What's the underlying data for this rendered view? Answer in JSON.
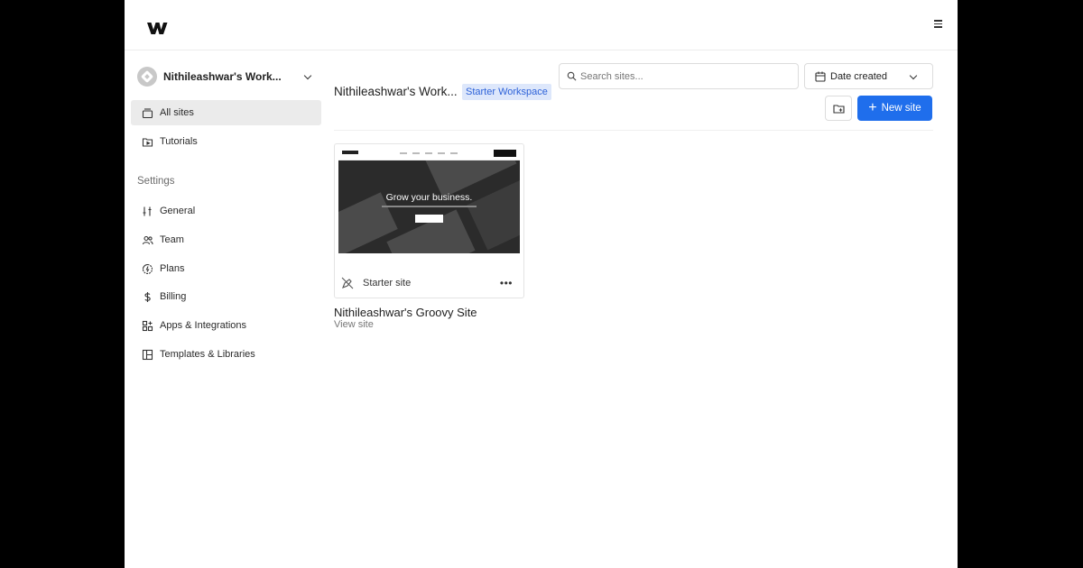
{
  "header": {
    "logo_icon": "webflow-logo-icon",
    "menu_icon": "hamburger-icon"
  },
  "sidebar": {
    "workspace_name": "Nithileashwar's Work...",
    "items": [
      {
        "label": "All sites",
        "icon": "sites-icon",
        "active": true
      },
      {
        "label": "Tutorials",
        "icon": "tutorial-icon",
        "active": false
      }
    ],
    "settings_label": "Settings",
    "settings_items": [
      {
        "label": "General",
        "icon": "sliders-icon"
      },
      {
        "label": "Team",
        "icon": "team-icon"
      },
      {
        "label": "Plans",
        "icon": "plans-icon"
      },
      {
        "label": "Billing",
        "icon": "dollar-icon"
      },
      {
        "label": "Apps & Integrations",
        "icon": "apps-icon"
      },
      {
        "label": "Templates & Libraries",
        "icon": "templates-icon"
      }
    ]
  },
  "main": {
    "workspace_title": "Nithileashwar's Work...",
    "plan_badge": "Starter Workspace",
    "search": {
      "placeholder": "Search sites..."
    },
    "sort": {
      "label": "Date created"
    },
    "new_site_label": "New site",
    "accent_color": "#1f6eec",
    "sites": [
      {
        "name": "Nithileashwar's Groovy Site",
        "plan": "Starter site",
        "link_label": "View site",
        "thumbnail_headline": "Grow your business."
      }
    ]
  }
}
